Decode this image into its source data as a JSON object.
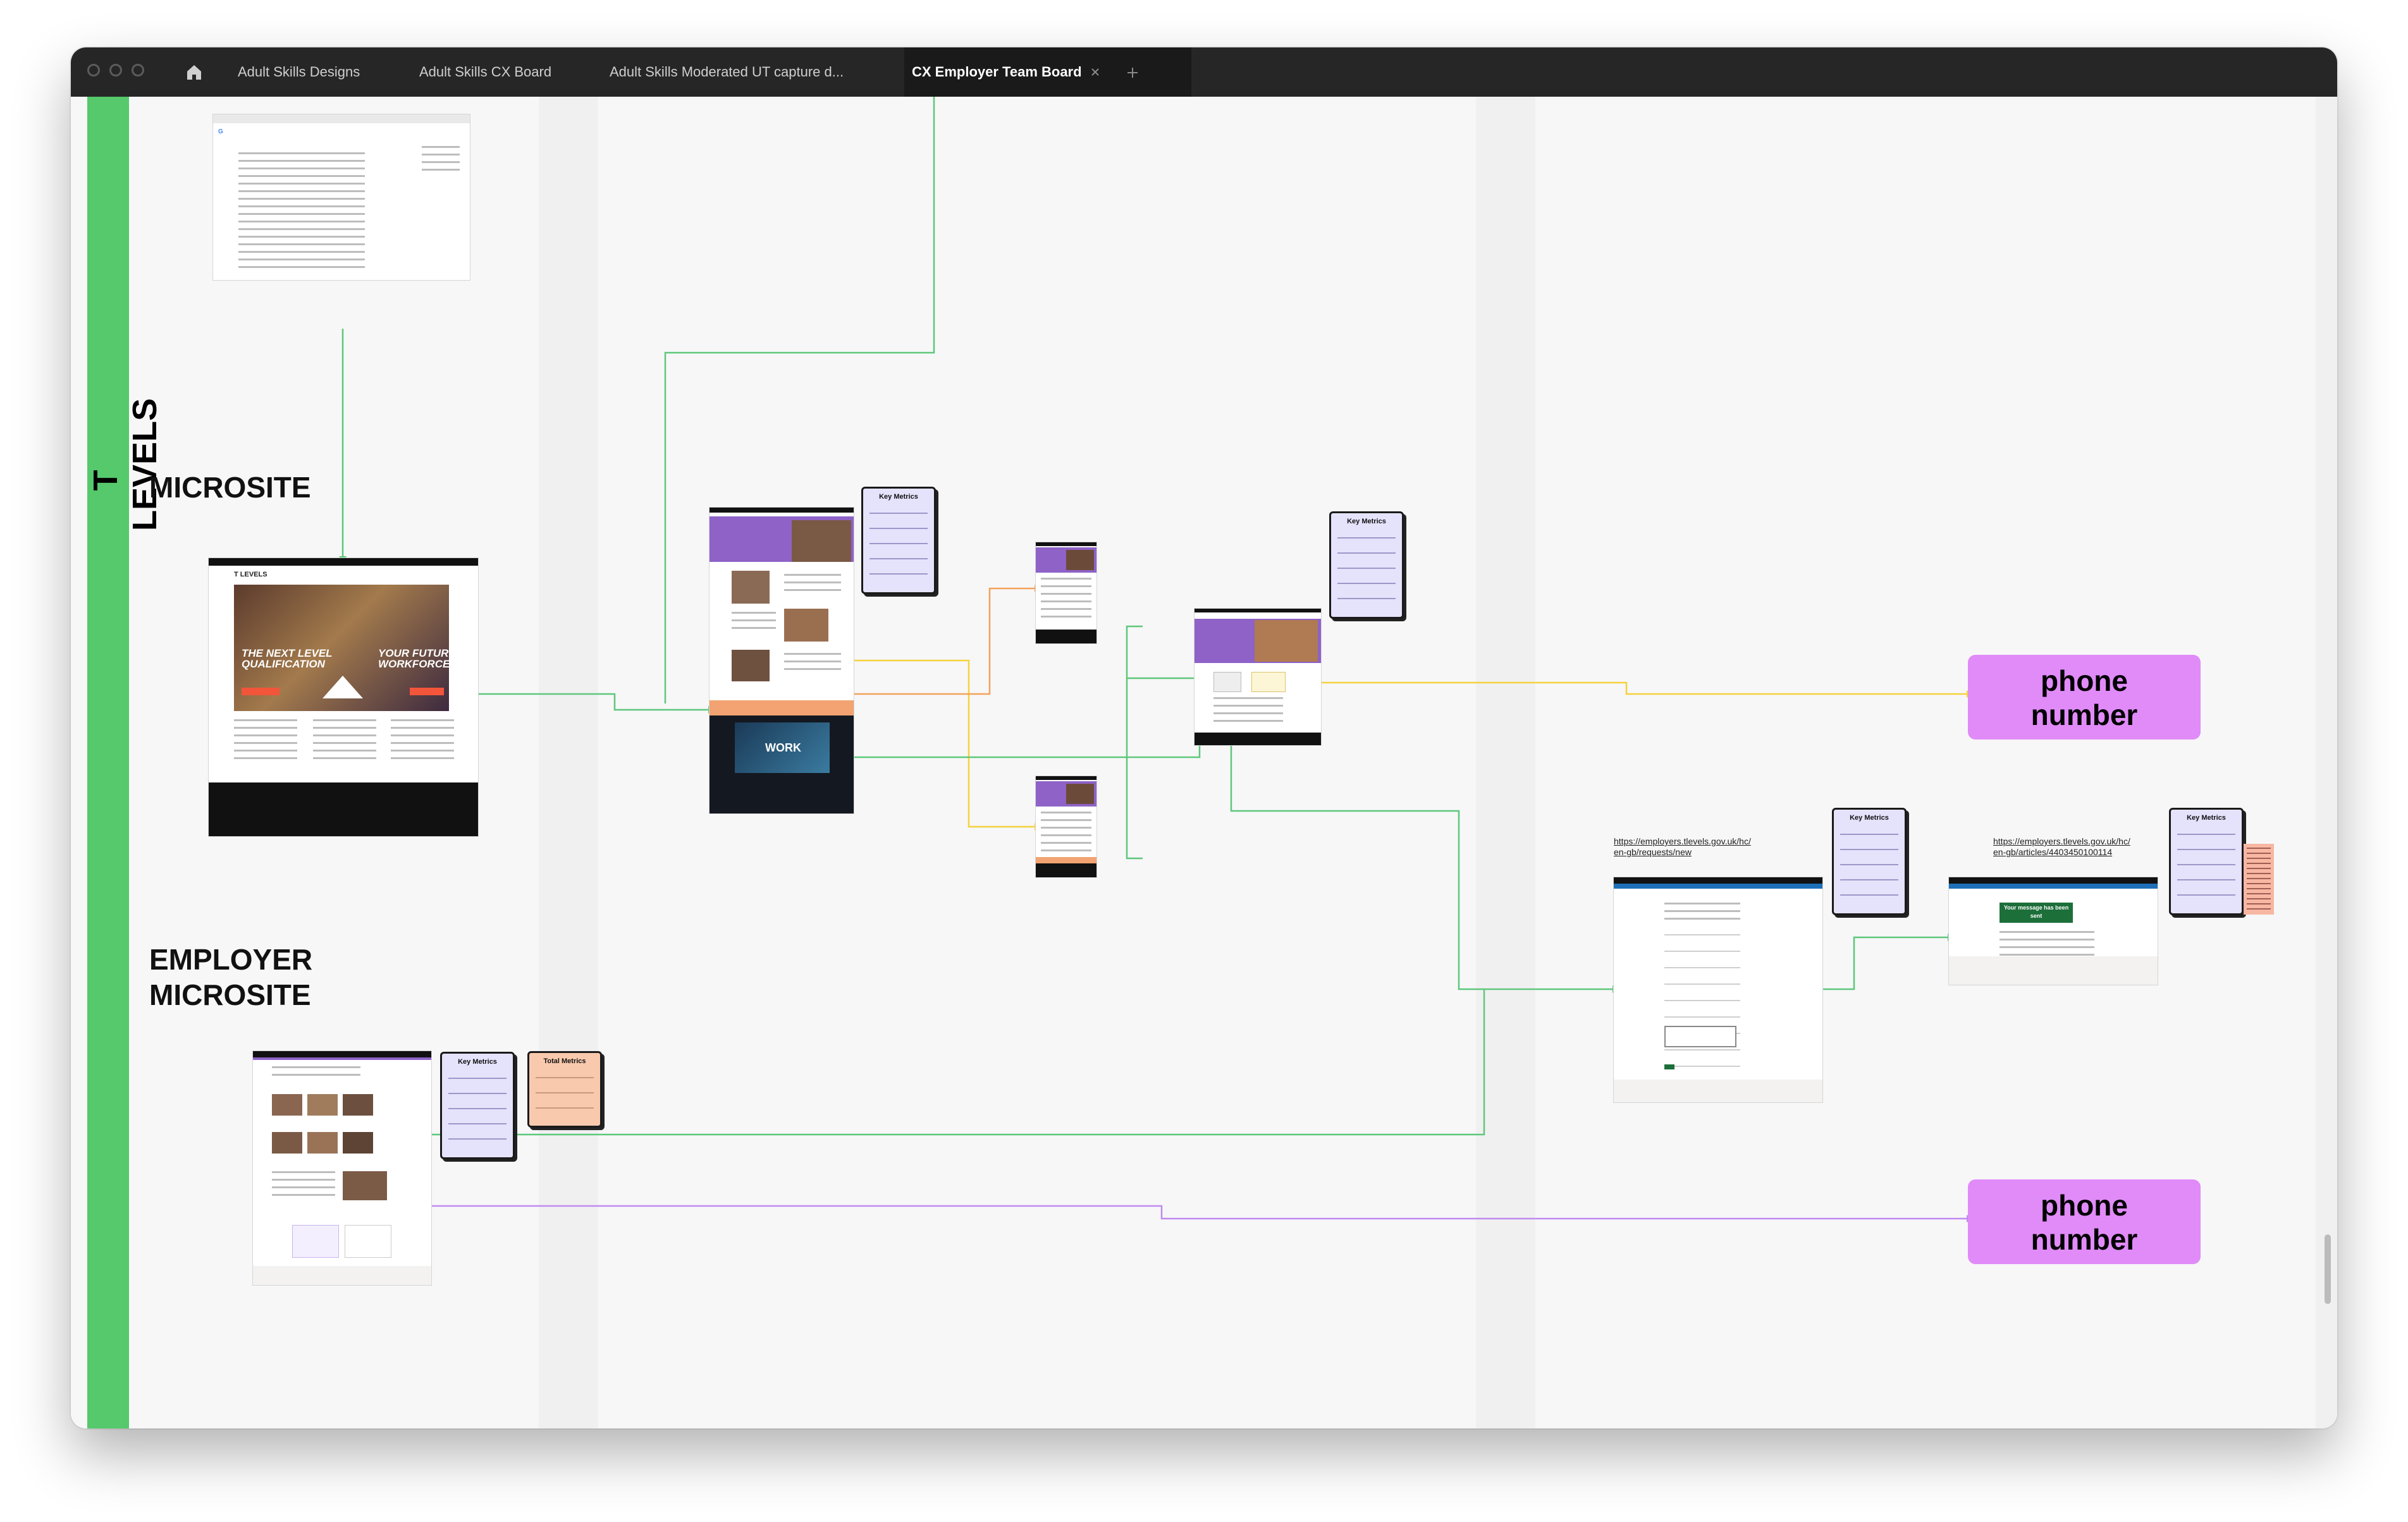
{
  "tabs": [
    {
      "label": "Adult Skills Designs",
      "active": false
    },
    {
      "label": "Adult Skills CX Board",
      "active": false
    },
    {
      "label": "Adult Skills Moderated UT capture d...",
      "active": false
    },
    {
      "label": "CX Employer Team Board",
      "active": true
    }
  ],
  "band_label": "T LEVELS",
  "sections": {
    "microsite": "MICROSITE",
    "employer_microsite": "EMPLOYER\nMICROSITE"
  },
  "cards": {
    "key_metrics": "Key Metrics",
    "total_metrics": "Total Metrics"
  },
  "phone_label": "phone\nnumber",
  "urls": {
    "requests_new": "https://employers.tlevels.gov.uk/hc/\nen-gb/requests/new",
    "article": "https://employers.tlevels.gov.uk/hc/\nen-gb/articles/4403450100114"
  },
  "hero": {
    "tlevels_logo": "T LEVELS",
    "next_level": "THE NEXT LEVEL\nQUALIFICATION",
    "future_workforce": "YOUR FUTURE\nWORKFORCE",
    "work": "WORK",
    "message_sent": "Your message has been sent"
  },
  "colors": {
    "green_band": "#55c96b",
    "purple": "#8e62c7",
    "phone_fill": "#e08bf8",
    "metrics_card": "#e5e2fb",
    "total_card": "#f9c9ad",
    "wire_green": "#5ec77b",
    "wire_yellow": "#f5d23c",
    "wire_orange": "#f2a35b",
    "wire_purple": "#c08af0"
  },
  "icons": [
    "home-icon",
    "close-icon",
    "plus-icon"
  ]
}
